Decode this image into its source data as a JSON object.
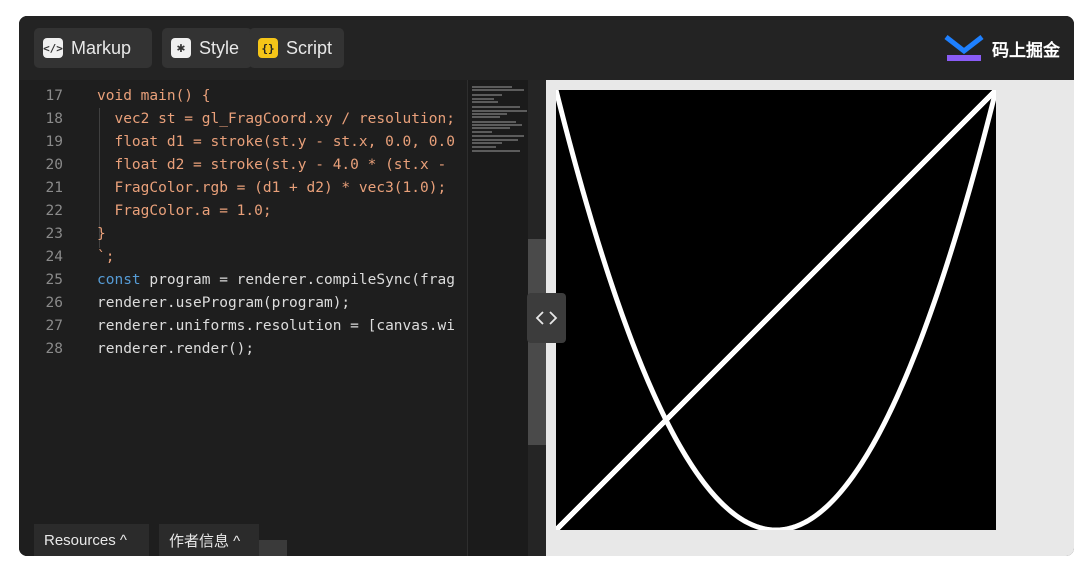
{
  "tabs": [
    {
      "label": "Markup",
      "icon": "code-tag-icon",
      "glyph": "</>"
    },
    {
      "label": "Style",
      "icon": "asterisk-icon",
      "glyph": "✱"
    },
    {
      "label": "Script",
      "icon": "braces-icon",
      "glyph": "{}"
    }
  ],
  "brand": {
    "name": "码上掘金",
    "color": "#1e80ff"
  },
  "code_lines": [
    {
      "n": "17",
      "text": "void main() {"
    },
    {
      "n": "18",
      "text": "  vec2 st = gl_FragCoord.xy / resolution;"
    },
    {
      "n": "19",
      "text": "  float d1 = stroke(st.y - st.x, 0.0, 0.0"
    },
    {
      "n": "20",
      "text": "  float d2 = stroke(st.y - 4.0 * (st.x -"
    },
    {
      "n": "21",
      "text": "  FragColor.rgb = (d1 + d2) * vec3(1.0);"
    },
    {
      "n": "22",
      "text": "  FragColor.a = 1.0;"
    },
    {
      "n": "23",
      "text": "}"
    },
    {
      "n": "24",
      "text": "`;"
    },
    {
      "n": "25",
      "kw": "const",
      "text": " program = renderer.compileSync(frag"
    },
    {
      "n": "26",
      "text": "renderer.useProgram(program);"
    },
    {
      "n": "27",
      "text": "renderer.uniforms.resolution = [canvas.wi"
    },
    {
      "n": "28",
      "text": "renderer.render();"
    }
  ],
  "bottom": {
    "resources": "Resources ^",
    "author": "作者信息 ^"
  },
  "splitter": {
    "left": "<",
    "right": ">"
  }
}
